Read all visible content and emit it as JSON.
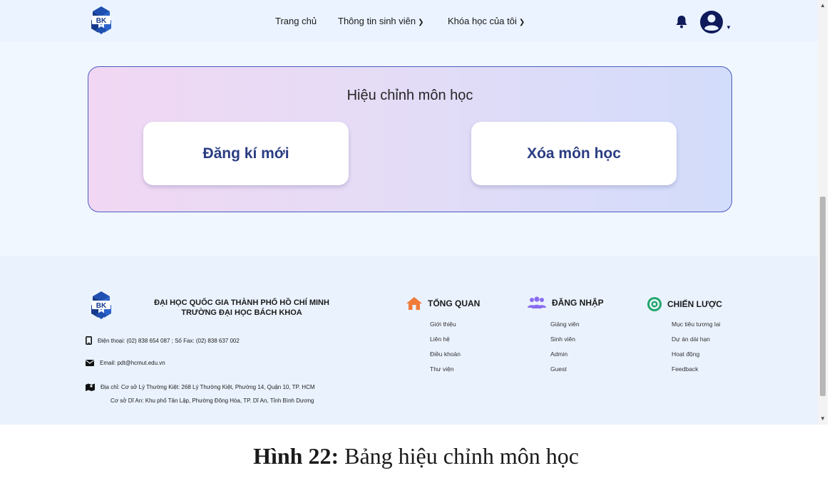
{
  "header": {
    "nav": [
      {
        "label": "Trang chủ",
        "has_dropdown": false
      },
      {
        "label": "Thông tin sinh viên",
        "has_dropdown": true
      },
      {
        "label": "Khóa học của tôi",
        "has_dropdown": true
      }
    ],
    "logo_text": "BK",
    "icons": [
      "bell-icon",
      "user-avatar-icon"
    ]
  },
  "panel": {
    "title": "Hiệu chỉnh môn học",
    "buttons": [
      "Đăng kí mới",
      "Xóa môn học"
    ]
  },
  "footer": {
    "university_line1": "ĐẠI HỌC QUỐC GIA THÀNH PHỐ HỒ CHÍ MINH",
    "university_line2": "TRƯỜNG ĐẠI HỌC BÁCH KHOA",
    "phone": "Điện thoại: (02) 838 654 087 ; Số Fax: (02) 838 637 002",
    "email": "Email: pdt@hcmut.edu.vn",
    "address1": "Địa chỉ: Cơ sở Lý Thường Kiệt: 268 Lý Thường Kiệt, Phường 14, Quận 10, TP. HCM",
    "address2": "Cơ sở Dĩ An: Khu phố Tân Lập, Phường Đông Hòa, TP. Dĩ An, Tỉnh Bình Dương",
    "columns": [
      {
        "heading": "TỔNG QUAN",
        "icon": "house-icon",
        "items": [
          "Giới thiệu",
          "Liên hệ",
          "Điều khoản",
          "Thư viện"
        ]
      },
      {
        "heading": "ĐĂNG NHẬP",
        "icon": "users-icon",
        "items": [
          "Giảng viên",
          "Sinh viên",
          "Admin",
          "Guest"
        ]
      },
      {
        "heading": "CHIẾN LƯỢC",
        "icon": "target-icon",
        "items": [
          "Mục tiêu tương lai",
          "Dự án dài hạn",
          "Hoạt động",
          "Feedback"
        ]
      }
    ]
  },
  "caption": {
    "label": "Hình 22:",
    "text": " Bảng hiệu chỉnh môn học"
  },
  "colors": {
    "accent_blue": "#2a3d82",
    "header_bg": "#eaf3ff",
    "panel_border": "#4a5dc0",
    "house_orange": "#f07b3a",
    "users_purple": "#8a6cf0",
    "target_green": "#1fa86a"
  }
}
